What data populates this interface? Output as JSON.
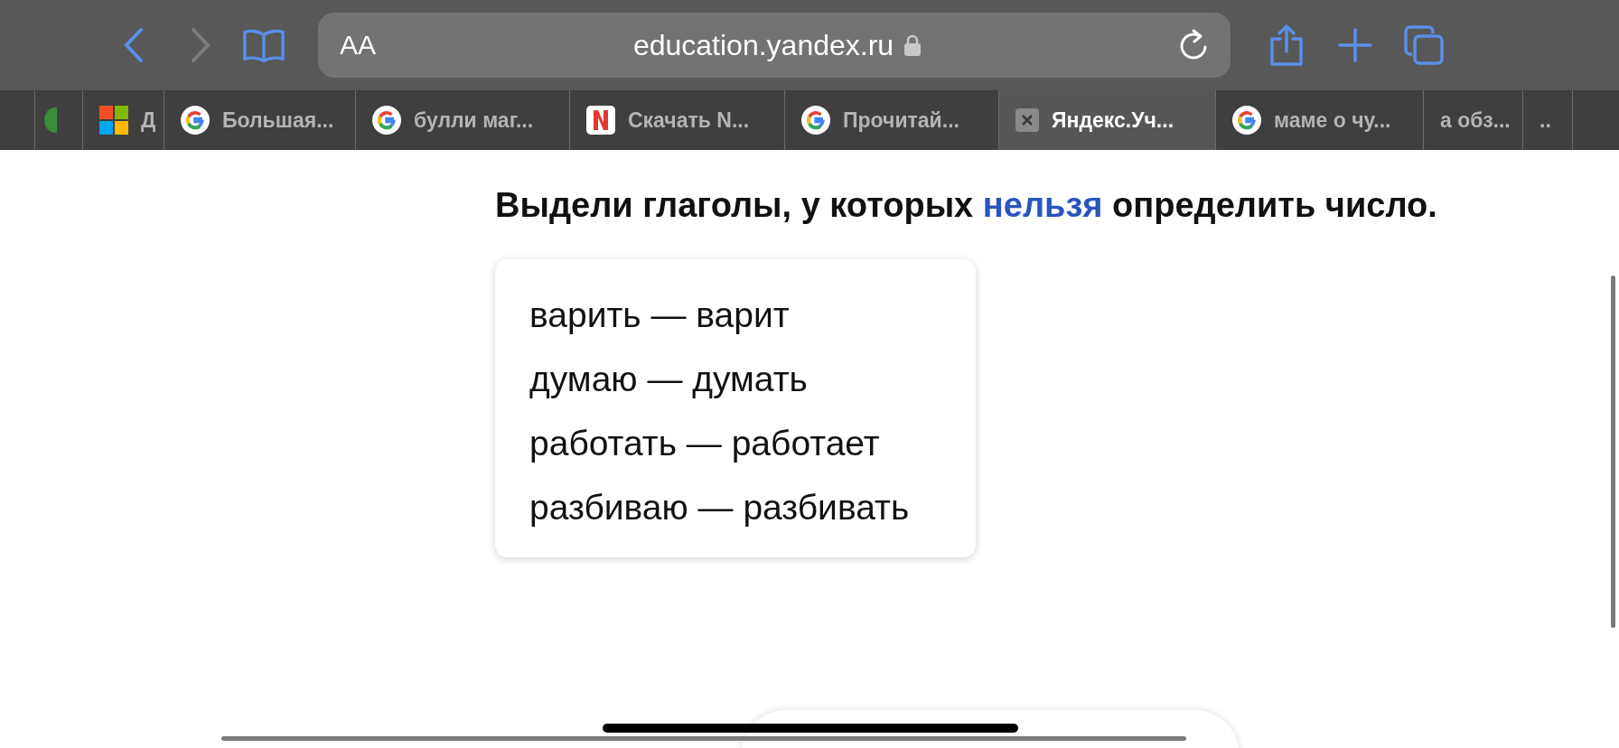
{
  "toolbar": {
    "text_size": "AA",
    "address": "education.yandex.ru"
  },
  "tabs": [
    {
      "kind": "leaf",
      "selected": false
    },
    {
      "kind": "squares",
      "title": "Д",
      "selected": false
    },
    {
      "kind": "google",
      "title": "Большая...",
      "selected": false
    },
    {
      "kind": "google",
      "title": "булли маг...",
      "selected": false
    },
    {
      "kind": "letter",
      "title": "Скачать N...",
      "selected": false
    },
    {
      "kind": "google",
      "title": "Прочитай...",
      "selected": false
    },
    {
      "kind": "closable",
      "title": "Яндекс.Уч...",
      "selected": true
    },
    {
      "kind": "google",
      "title": "маме о чу...",
      "selected": false
    },
    {
      "kind": "plain",
      "title": "а обз...",
      "selected": false
    },
    {
      "kind": "plain",
      "title": "..",
      "selected": false
    },
    {
      "kind": "plain",
      "selected": false
    }
  ],
  "task": {
    "prompt": "Выдели глаголы, у которых **нельзя** определить число.",
    "options": [
      {
        "text": "варить — варит",
        "selected": false
      },
      {
        "text": "думаю — думать",
        "selected": false
      },
      {
        "text": "работать — работает",
        "selected": false
      },
      {
        "text": "разбиваю — разбивать",
        "selected": false
      }
    ]
  }
}
